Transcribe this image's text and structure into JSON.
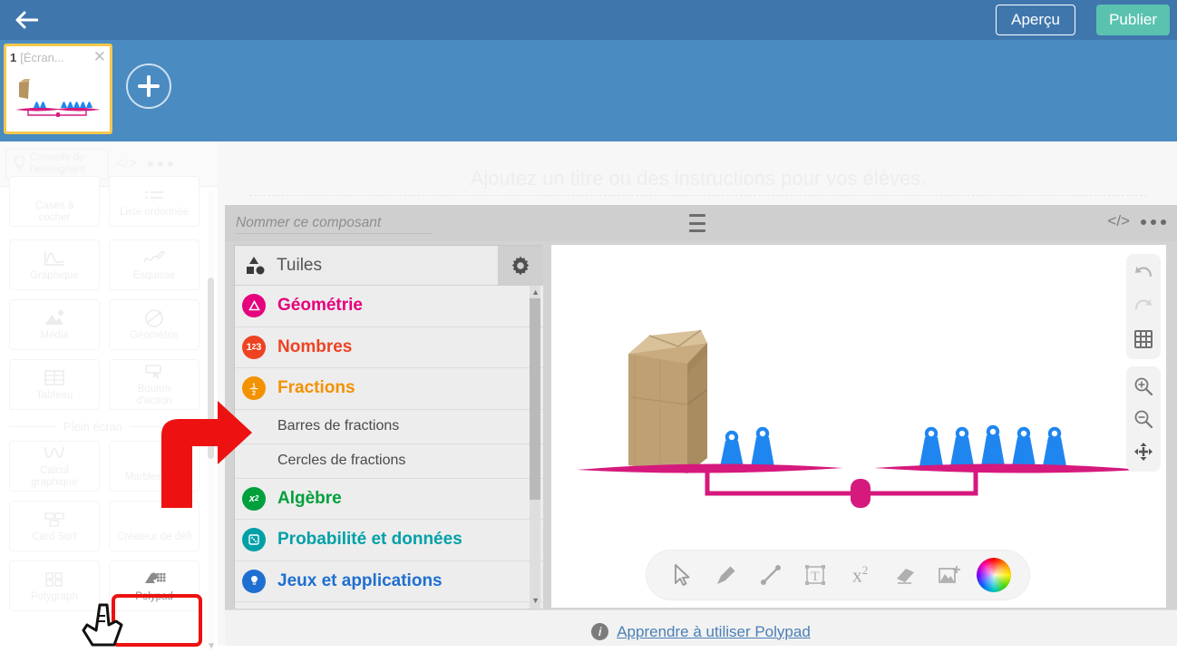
{
  "topbar": {
    "back_icon": "arrow-left-icon",
    "preview_label": "Aperçu",
    "publish_label": "Publier",
    "bg_color": "#3f77ad",
    "publish_color": "#5bc2b0"
  },
  "slide_strip": {
    "bg_color": "#4a8bc2",
    "slides": [
      {
        "number": "1",
        "title": "[Écran...",
        "close_icon": "close-icon"
      }
    ],
    "add_label": "+",
    "add_icon": "plus-icon"
  },
  "sidebar": {
    "teacher_tips": {
      "label": "Conseils de l'enseignant",
      "icon": "lightbulb-icon"
    },
    "code_icon": "code-icon",
    "more_icon": "more-dots-icon",
    "tools_rows": [
      [
        {
          "label": "Cases à\ncocher",
          "icon": "checkbox-icon"
        },
        {
          "label": "Liste ordonnée",
          "icon": "ordered-list-icon"
        }
      ],
      [
        {
          "label": "Graphique",
          "icon": "graph-icon"
        },
        {
          "label": "Esquisse",
          "icon": "sketch-icon"
        }
      ],
      [
        {
          "label": "Média",
          "icon": "image-icon"
        },
        {
          "label": "Géométrie",
          "icon": "geometry-icon"
        }
      ],
      [
        {
          "label": "Tableau",
          "icon": "table-icon"
        },
        {
          "label": "Bouton\nd'action",
          "icon": "action-button-icon"
        }
      ]
    ],
    "section_label": "Plein écran",
    "fullscreen_rows": [
      [
        {
          "label": "Calcul\ngraphique",
          "icon": "graphing-calculator-icon"
        },
        {
          "label": "Marbleslides",
          "icon": "marbleslides-icon"
        }
      ],
      [
        {
          "label": "Card Sort",
          "icon": "card-sort-icon"
        },
        {
          "label": "Créateur de défi",
          "icon": "challenge-creator-icon"
        }
      ],
      [
        {
          "label": "Polygraph",
          "icon": "polygraph-icon"
        },
        {
          "label": "Polypad",
          "icon": "polypad-icon"
        }
      ]
    ],
    "highlight": {
      "target": "Polypad",
      "color": "#ee1111"
    }
  },
  "main": {
    "title_placeholder": "Ajoutez un titre ou des instructions pour vos élèves."
  },
  "component": {
    "name_placeholder": "Nommer ce composant",
    "name_value": "",
    "menu_icon": "hamburger-icon",
    "code_icon": "code-icon",
    "more_icon": "more-dots-icon",
    "footer": {
      "info_icon": "info-icon",
      "link_label": "Apprendre à utiliser Polypad"
    }
  },
  "tiles_panel": {
    "header_label": "Tuiles",
    "header_icon": "shapes-icon",
    "settings_icon": "gear-icon",
    "items": [
      {
        "label": "Géométrie",
        "color": "#e5007d",
        "badge": "geometry-icon",
        "type": "category"
      },
      {
        "label": "Nombres",
        "color": "#ee4323",
        "badge": "123",
        "type": "category"
      },
      {
        "label": "Fractions",
        "color": "#f39200",
        "badge": "½",
        "type": "category"
      },
      {
        "label": "Barres de fractions",
        "type": "sub"
      },
      {
        "label": "Cercles de fractions",
        "type": "sub"
      },
      {
        "label": "Algèbre",
        "color": "#00a03c",
        "badge": "x²",
        "type": "category"
      },
      {
        "label": "Probabilité et données",
        "color": "#00a0a8",
        "badge": "dice-icon",
        "type": "category"
      },
      {
        "label": "Jeux et applications",
        "color": "#1f6fd0",
        "badge": "bulb-icon",
        "type": "category"
      }
    ]
  },
  "canvas": {
    "vertical_tools": [
      {
        "name": "undo-icon",
        "label": "Annuler"
      },
      {
        "name": "redo-icon",
        "label": "Rétablir"
      },
      {
        "name": "grid-icon",
        "label": "Grille"
      },
      {
        "name": "zoom-in-icon",
        "label": "Zoom avant"
      },
      {
        "name": "zoom-out-icon",
        "label": "Zoom arrière"
      },
      {
        "name": "pan-move-icon",
        "label": "Déplacer"
      }
    ],
    "bottom_tools": [
      {
        "name": "select-cursor-icon",
        "label": "Sélection"
      },
      {
        "name": "pen-icon",
        "label": "Crayon"
      },
      {
        "name": "line-icon",
        "label": "Ligne"
      },
      {
        "name": "text-box-icon",
        "label": "Texte"
      },
      {
        "name": "equation-icon",
        "label": "Équation"
      },
      {
        "name": "eraser-icon",
        "label": "Gomme"
      },
      {
        "name": "add-image-icon",
        "label": "Ajouter une image"
      },
      {
        "name": "color-wheel-icon",
        "label": "Couleur"
      }
    ],
    "scene": {
      "description": "Balance à fléau",
      "beam_color": "#d6197d",
      "weight_color": "#1f86f0",
      "bag_color": "#c4a478",
      "left_pan": {
        "bag_count": 1,
        "weight_count": 2
      },
      "right_pan": {
        "weight_count": 5
      }
    }
  }
}
